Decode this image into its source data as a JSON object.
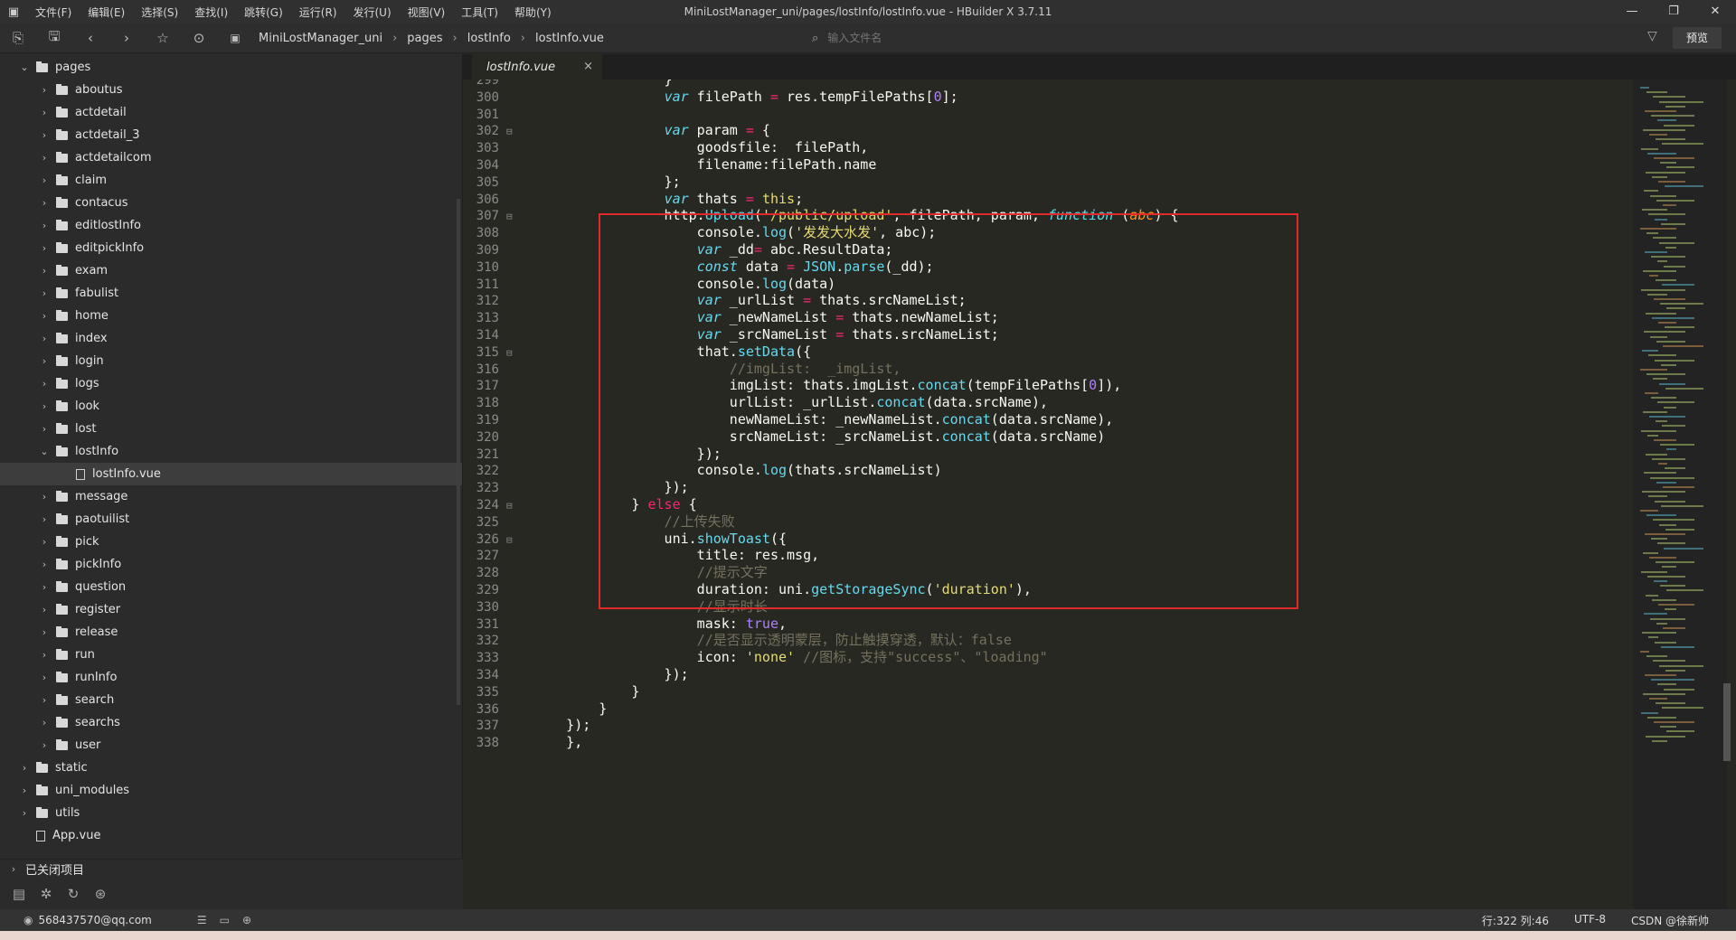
{
  "window": {
    "title": "MiniLostManager_uni/pages/lostInfo/lostInfo.vue - HBuilder X 3.7.11",
    "controls": [
      "—",
      "❐",
      "✕"
    ]
  },
  "menu": [
    "文件(F)",
    "编辑(E)",
    "选择(S)",
    "查找(I)",
    "跳转(G)",
    "运行(R)",
    "发行(U)",
    "视图(V)",
    "工具(T)",
    "帮助(Y)"
  ],
  "toolbar": {
    "icons": [
      "new-file-icon",
      "save-icon",
      "back-icon",
      "forward-icon",
      "star-icon",
      "run-icon"
    ],
    "breadcrumb": [
      "MiniLostManager_uni",
      "pages",
      "lostInfo",
      "lostInfo.vue"
    ],
    "search_placeholder": "输入文件名",
    "preview_label": "预览"
  },
  "sidebar": {
    "items": [
      {
        "label": "pages",
        "depth": 1,
        "type": "folder",
        "open": true
      },
      {
        "label": "aboutus",
        "depth": 2,
        "type": "folder"
      },
      {
        "label": "actdetail",
        "depth": 2,
        "type": "folder"
      },
      {
        "label": "actdetail_3",
        "depth": 2,
        "type": "folder"
      },
      {
        "label": "actdetailcom",
        "depth": 2,
        "type": "folder"
      },
      {
        "label": "claim",
        "depth": 2,
        "type": "folder"
      },
      {
        "label": "contacus",
        "depth": 2,
        "type": "folder"
      },
      {
        "label": "editlostInfo",
        "depth": 2,
        "type": "folder"
      },
      {
        "label": "editpickInfo",
        "depth": 2,
        "type": "folder"
      },
      {
        "label": "exam",
        "depth": 2,
        "type": "folder"
      },
      {
        "label": "fabulist",
        "depth": 2,
        "type": "folder"
      },
      {
        "label": "home",
        "depth": 2,
        "type": "folder"
      },
      {
        "label": "index",
        "depth": 2,
        "type": "folder"
      },
      {
        "label": "login",
        "depth": 2,
        "type": "folder"
      },
      {
        "label": "logs",
        "depth": 2,
        "type": "folder"
      },
      {
        "label": "look",
        "depth": 2,
        "type": "folder"
      },
      {
        "label": "lost",
        "depth": 2,
        "type": "folder"
      },
      {
        "label": "lostInfo",
        "depth": 2,
        "type": "folder",
        "open": true
      },
      {
        "label": "lostInfo.vue",
        "depth": 3,
        "type": "file",
        "selected": true
      },
      {
        "label": "message",
        "depth": 2,
        "type": "folder"
      },
      {
        "label": "paotuilist",
        "depth": 2,
        "type": "folder"
      },
      {
        "label": "pick",
        "depth": 2,
        "type": "folder"
      },
      {
        "label": "pickInfo",
        "depth": 2,
        "type": "folder"
      },
      {
        "label": "question",
        "depth": 2,
        "type": "folder"
      },
      {
        "label": "register",
        "depth": 2,
        "type": "folder"
      },
      {
        "label": "release",
        "depth": 2,
        "type": "folder"
      },
      {
        "label": "run",
        "depth": 2,
        "type": "folder"
      },
      {
        "label": "runInfo",
        "depth": 2,
        "type": "folder"
      },
      {
        "label": "search",
        "depth": 2,
        "type": "folder"
      },
      {
        "label": "searchs",
        "depth": 2,
        "type": "folder"
      },
      {
        "label": "user",
        "depth": 2,
        "type": "folder"
      },
      {
        "label": "static",
        "depth": 1,
        "type": "folder"
      },
      {
        "label": "uni_modules",
        "depth": 1,
        "type": "folder"
      },
      {
        "label": "utils",
        "depth": 1,
        "type": "folder"
      },
      {
        "label": "App.vue",
        "depth": 1,
        "type": "file"
      }
    ],
    "closed_projects": "已关闭项目",
    "bottom_icons": [
      "project-icon",
      "debug-icon",
      "refresh-icon",
      "plugin-icon"
    ]
  },
  "tab": {
    "label": "lostInfo.vue",
    "close": "×"
  },
  "code": [
    {
      "n": "299",
      "fold": false,
      "html": "            }"
    },
    {
      "n": "300",
      "fold": false,
      "html": "            <span class='kw'>var</span> filePath <span class='op'>=</span> res.tempFilePaths[<span class='num'>0</span>];"
    },
    {
      "n": "301",
      "fold": false,
      "html": ""
    },
    {
      "n": "302",
      "fold": true,
      "html": "            <span class='kw'>var</span> param <span class='op'>=</span> {"
    },
    {
      "n": "303",
      "fold": false,
      "html": "                goodsfile:  filePath,"
    },
    {
      "n": "304",
      "fold": false,
      "html": "                filename:filePath.name"
    },
    {
      "n": "305",
      "fold": false,
      "html": "            };"
    },
    {
      "n": "306",
      "fold": false,
      "html": "            <span class='kw'>var</span> thats <span class='op'>=</span> <span class='str'>this</span>;"
    },
    {
      "n": "307",
      "fold": true,
      "html": "            http.<span class='fn'>Upload</span>(<span class='str'>'/public/upload'</span>, filePath, param, <span class='kw'>function</span> (<span class='pm'>abc</span>) {"
    },
    {
      "n": "308",
      "fold": false,
      "html": "                console.<span class='fn'>log</span>(<span class='str'>'发发大水发'</span>, abc);"
    },
    {
      "n": "309",
      "fold": false,
      "html": "                <span class='kw'>var</span> _dd<span class='op'>=</span> abc.ResultData;"
    },
    {
      "n": "310",
      "fold": false,
      "html": "                <span class='kw'>const</span> data <span class='op'>=</span> <span class='fn'>JSON</span>.<span class='fn'>parse</span>(_dd);"
    },
    {
      "n": "311",
      "fold": false,
      "html": "                console.<span class='fn'>log</span>(data)"
    },
    {
      "n": "312",
      "fold": false,
      "html": "                <span class='kw'>var</span> _urlList <span class='op'>=</span> thats.srcNameList;"
    },
    {
      "n": "313",
      "fold": false,
      "html": "                <span class='kw'>var</span> _newNameList <span class='op'>=</span> thats.newNameList;"
    },
    {
      "n": "314",
      "fold": false,
      "html": "                <span class='kw'>var</span> _srcNameList <span class='op'>=</span> thats.srcNameList;"
    },
    {
      "n": "315",
      "fold": true,
      "html": "                that.<span class='fn'>setData</span>({"
    },
    {
      "n": "316",
      "fold": false,
      "html": "                    <span class='cm'>//imgList:  _imgList,</span>"
    },
    {
      "n": "317",
      "fold": false,
      "html": "                    imgList: thats.imgList.<span class='fn'>concat</span>(tempFilePaths[<span class='num'>0</span>]),"
    },
    {
      "n": "318",
      "fold": false,
      "html": "                    urlList: _urlList.<span class='fn'>concat</span>(data.srcName),"
    },
    {
      "n": "319",
      "fold": false,
      "html": "                    newNameList: _newNameList.<span class='fn'>concat</span>(data.srcName),"
    },
    {
      "n": "320",
      "fold": false,
      "html": "                    srcNameList: _srcNameList.<span class='fn'>concat</span>(data.srcName)"
    },
    {
      "n": "321",
      "fold": false,
      "html": "                });"
    },
    {
      "n": "322",
      "fold": false,
      "html": "                console.<span class='fn'>log</span>(thats.srcNameList)"
    },
    {
      "n": "323",
      "fold": false,
      "html": "            });"
    },
    {
      "n": "324",
      "fold": true,
      "html": "        } <span class='op'>else</span> {"
    },
    {
      "n": "325",
      "fold": false,
      "html": "            <span class='cm'>//上传失败</span>"
    },
    {
      "n": "326",
      "fold": true,
      "html": "            uni.<span class='fn'>showToast</span>({"
    },
    {
      "n": "327",
      "fold": false,
      "html": "                title: res.msg,"
    },
    {
      "n": "328",
      "fold": false,
      "html": "                <span class='cm'>//提示文字</span>"
    },
    {
      "n": "329",
      "fold": false,
      "html": "                duration: uni.<span class='fn'>getStorageSync</span>(<span class='str'>'duration'</span>),"
    },
    {
      "n": "330",
      "fold": false,
      "html": "                <span class='cm'>//显示时长</span>"
    },
    {
      "n": "331",
      "fold": false,
      "html": "                mask: <span class='tv'>true</span>,"
    },
    {
      "n": "332",
      "fold": false,
      "html": "                <span class='cm'>//是否显示透明蒙层，防止触摸穿透，默认：false</span>"
    },
    {
      "n": "333",
      "fold": false,
      "html": "                icon: <span class='str'>'none'</span> <span class='cm'>//图标，支持\"success\"、\"loading\"</span>"
    },
    {
      "n": "334",
      "fold": false,
      "html": "            });"
    },
    {
      "n": "335",
      "fold": false,
      "html": "        }"
    },
    {
      "n": "336",
      "fold": false,
      "html": "    }"
    },
    {
      "n": "337",
      "fold": false,
      "html": "});"
    },
    {
      "n": "338",
      "fold": false,
      "html": "},"
    }
  ],
  "status": {
    "user": "568437570@qq.com",
    "position": "行:322  列:46",
    "encoding": "UTF-8",
    "watermark": "CSDN @徐新帅"
  },
  "colors": {
    "accent_box": "#e12a2a",
    "editor_bg": "#272822",
    "keyword": "#66d9ef",
    "string": "#e6db74",
    "comment": "#75715e"
  }
}
